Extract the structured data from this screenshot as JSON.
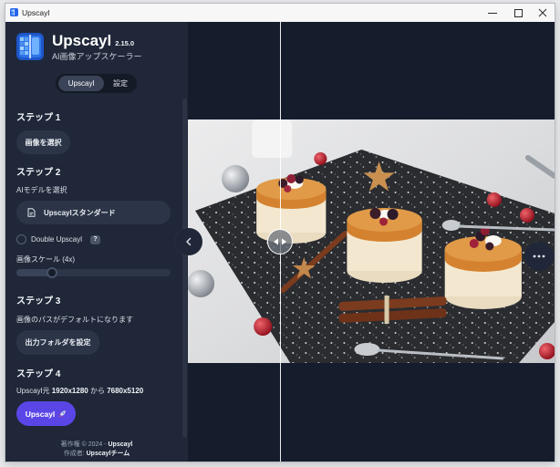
{
  "window": {
    "title": "Upscayl"
  },
  "header": {
    "app_name": "Upscayl",
    "version": "2.15.0",
    "tagline": "AI画像アップスケーラー"
  },
  "tabs": [
    {
      "label": "Upscayl",
      "selected": true
    },
    {
      "label": "設定",
      "selected": false
    }
  ],
  "step1": {
    "title": "ステップ 1",
    "select_image_button": "画像を選択"
  },
  "step2": {
    "title": "ステップ 2",
    "model_label": "AIモデルを選択",
    "model_value": "Upscaylスタンダード",
    "double_upscayl_label": "Double Upscayl",
    "double_upscayl_checked": false,
    "help_badge": "?",
    "scale_label": "画像スケール (4x)",
    "scale_slider_level": 0.21
  },
  "step3": {
    "title": "ステップ 3",
    "path_note": "画像のパスがデフォルトになります",
    "output_folder_button": "出力フォルダを設定"
  },
  "step4": {
    "title": "ステップ 4",
    "size_prefix": "Upscayl元 ",
    "size_from": "1920x1280",
    "size_joiner": " から ",
    "size_to": "7680x5120",
    "upscayl_button": "Upscayl"
  },
  "footer": {
    "copyright_prefix": "著作権 © 2024 - ",
    "copyright_name": "Upscayl",
    "author_prefix": "作成者: ",
    "author_name": "Upscaylチーム"
  },
  "compare": {
    "slider_position": 0.25
  },
  "icons": {
    "app": "upscayl-logo",
    "model": "model-icon",
    "upscayl_button": "rocket-icon",
    "collapse": "chevron-left-icon",
    "compare_handle": "compare-arrows-icon",
    "more": "more-icon"
  },
  "colors": {
    "sidebar_bg": "#1f2738",
    "main_bg": "#151c2c",
    "button_bg": "#2c3547",
    "accent": "#5a46e6"
  }
}
